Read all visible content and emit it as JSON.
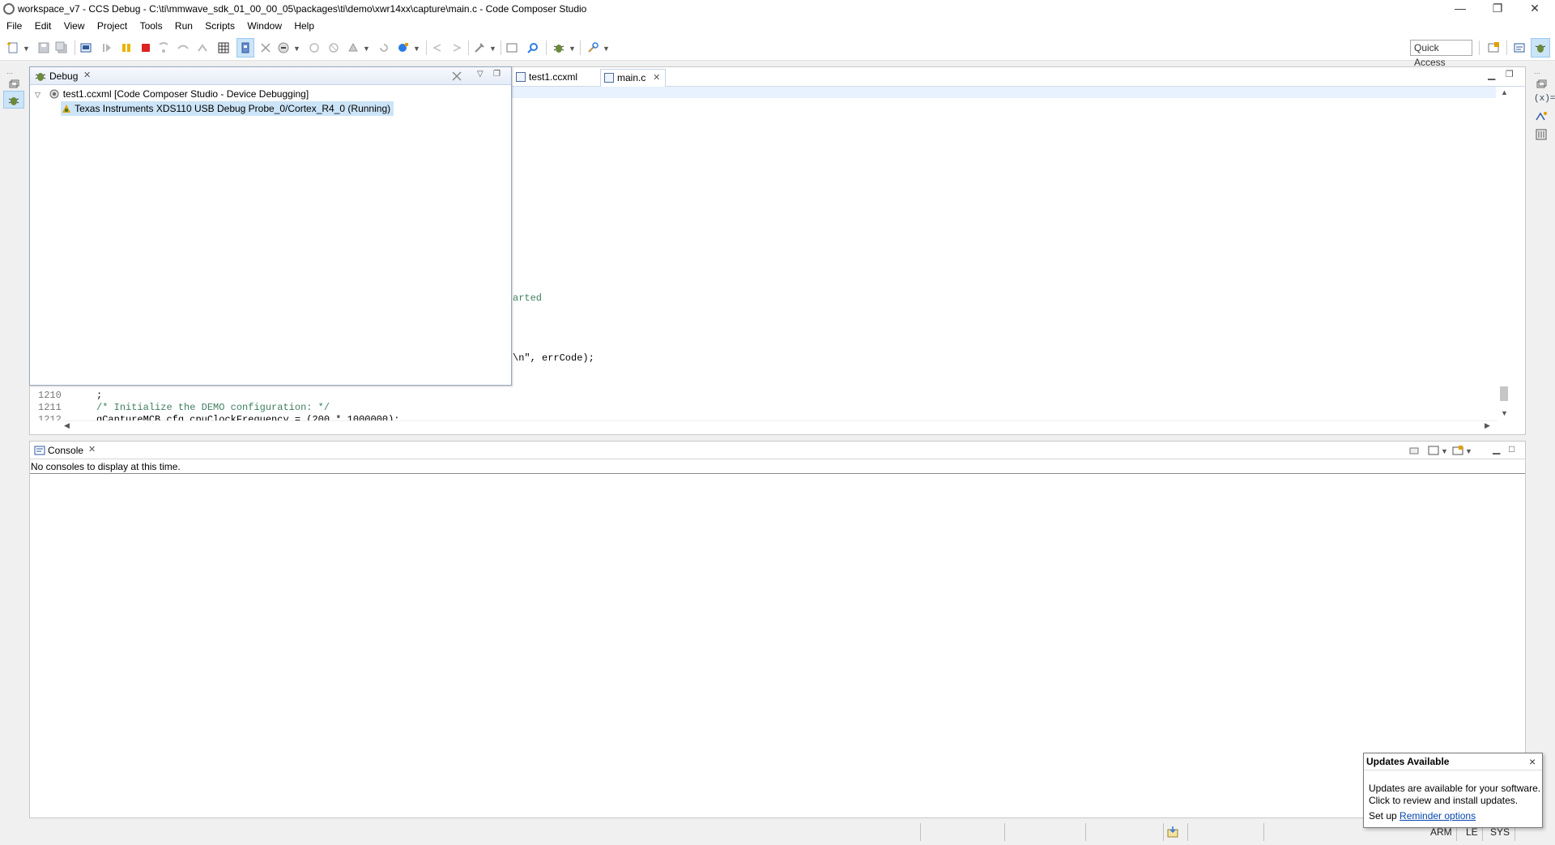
{
  "window": {
    "title": "workspace_v7 - CCS Debug - C:\\ti\\mmwave_sdk_01_00_00_05\\packages\\ti\\demo\\xwr14xx\\capture\\main.c - Code Composer Studio",
    "minimize": "—",
    "restore": "❐",
    "close": "✕"
  },
  "menu": [
    "File",
    "Edit",
    "View",
    "Project",
    "Tools",
    "Run",
    "Scripts",
    "Window",
    "Help"
  ],
  "toolbar": {
    "quick_access": "Quick Access"
  },
  "editor": {
    "tabs": [
      {
        "label": "test1.ccxml"
      },
      {
        "label": "main.c"
      }
    ],
    "visible_fragments": [
      {
        "text": "arted",
        "class": "cmt"
      },
      {
        "text": "\\n\", errCode);",
        "class": ""
      }
    ],
    "lines": [
      {
        "num": "1210",
        "text": "    ;"
      },
      {
        "num": "1211",
        "text": "    /* Initialize the DEMO configuration: */"
      },
      {
        "num": "1212",
        "text": "    gCaptureMCB.cfg.cpuClockFrequency = (200 * 1000000);"
      }
    ]
  },
  "debug_view": {
    "tab_label": "Debug",
    "tree": [
      {
        "label": "test1.ccxml [Code Composer Studio - Device Debugging]"
      },
      {
        "label": "Texas Instruments XDS110 USB Debug Probe_0/Cortex_R4_0 (Running)"
      }
    ]
  },
  "console": {
    "tab_label": "Console",
    "message": "No consoles to display at this time."
  },
  "status": {
    "cells": [
      "ARM",
      "LE",
      "SYS"
    ]
  },
  "updates_popup": {
    "title": "Updates Available",
    "close": "×",
    "line1": "Updates are available for your software.",
    "line2": "Click to review and install updates.",
    "setup_prefix": "Set up ",
    "setup_link": "Reminder options"
  }
}
